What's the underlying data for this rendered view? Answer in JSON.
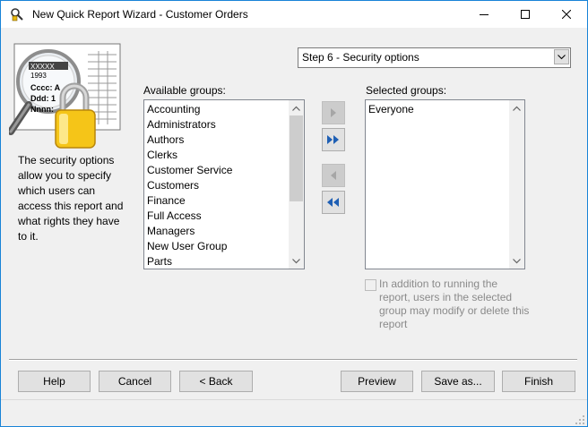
{
  "window": {
    "title": "New Quick Report Wizard - Customer Orders",
    "app_icon": "quick-report-icon",
    "controls": [
      "minimize-icon",
      "maximize-icon",
      "close-icon"
    ]
  },
  "illustration": {
    "icon": "security-lock-magnifier-icon",
    "lines": [
      "XXXXX",
      "1993",
      "Cccc: A",
      "Ddd: 1",
      "Nnnn:"
    ]
  },
  "side_text": "The security options allow you to specify which users can access this report and what rights they have to it.",
  "step_select": {
    "value": "Step 6 - Security options"
  },
  "available": {
    "label": "Available groups:",
    "items": [
      "Accounting",
      "Administrators",
      "Authors",
      "Clerks",
      "Customer Service",
      "Customers",
      "Finance",
      "Full Access",
      "Managers",
      "New User Group",
      "Parts"
    ]
  },
  "selected": {
    "label": "Selected groups:",
    "items": [
      "Everyone"
    ]
  },
  "move_buttons": {
    "add": "arrow-right-icon",
    "add_all": "double-arrow-right-icon",
    "remove": "arrow-left-icon",
    "remove_all": "double-arrow-left-icon"
  },
  "checkbox": {
    "label": "In addition to running the report, users in the selected group may modify or delete this report",
    "checked": false,
    "disabled": true
  },
  "buttons": {
    "help": "Help",
    "cancel": "Cancel",
    "back": "< Back",
    "preview": "Preview",
    "save_as": "Save as...",
    "finish": "Finish"
  },
  "colors": {
    "window_border": "#1883d7",
    "move_arrow_blue": "#1e5fb4",
    "lock_gold": "#f5c518"
  }
}
